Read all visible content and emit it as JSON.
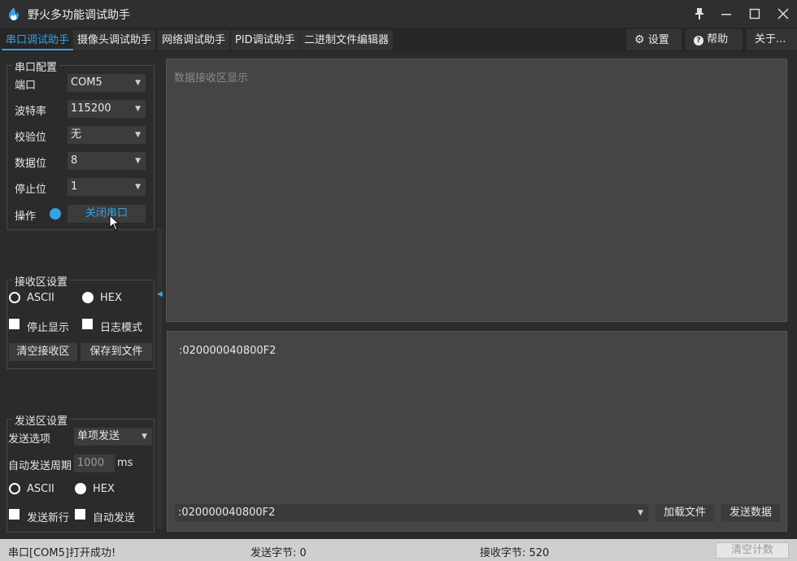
{
  "window": {
    "title": "野火多功能调试助手",
    "controls": [
      "pin-icon",
      "minimize-icon",
      "maximize-icon",
      "close-icon"
    ]
  },
  "tabs": [
    {
      "label": "串口调试助手",
      "active": true
    },
    {
      "label": "摄像头调试助手",
      "active": false
    },
    {
      "label": "网络调试助手",
      "active": false
    },
    {
      "label": "PID调试助手",
      "active": false
    },
    {
      "label": "二进制文件编辑器",
      "active": false
    }
  ],
  "top_buttons": {
    "settings": "设置",
    "help": "帮助",
    "about": "关于..."
  },
  "serial_config": {
    "group_title": "串口配置",
    "port_label": "端口",
    "port_value": "COM5",
    "baud_label": "波特率",
    "baud_value": "115200",
    "parity_label": "校验位",
    "parity_value": "无",
    "databits_label": "数据位",
    "databits_value": "8",
    "stopbits_label": "停止位",
    "stopbits_value": "1",
    "operation_label": "操作",
    "close_port_button": "关闭串口"
  },
  "recv_settings": {
    "group_title": "接收区设置",
    "ascii_label": "ASCII",
    "hex_label": "HEX",
    "hex_selected": true,
    "stop_display_label": "停止显示",
    "log_mode_label": "日志模式",
    "clear_recv_button": "清空接收区",
    "save_file_button": "保存到文件"
  },
  "send_settings": {
    "group_title": "发送区设置",
    "send_option_label": "发送选项",
    "send_option_value": "单项发送",
    "auto_period_label": "自动发送周期",
    "auto_period_value": "1000",
    "auto_period_unit": "ms",
    "ascii_label": "ASCII",
    "hex_label": "HEX",
    "send_newline_label": "发送新行",
    "auto_send_label": "自动发送"
  },
  "recv_area": {
    "placeholder": "数据接收区显示"
  },
  "send_area": {
    "content": ":020000040800F2",
    "input_value": ":020000040800F2",
    "load_file_button": "加载文件",
    "send_data_button": "发送数据"
  },
  "status": {
    "message": "串口[COM5]打开成功!",
    "sent_bytes": "发送字节: 0",
    "recv_bytes": "接收字节: 520",
    "clear_count_button": "清空计数"
  },
  "colors": {
    "accent": "#3aa0e6",
    "background": "#2b2b2b",
    "panel": "#454545"
  }
}
